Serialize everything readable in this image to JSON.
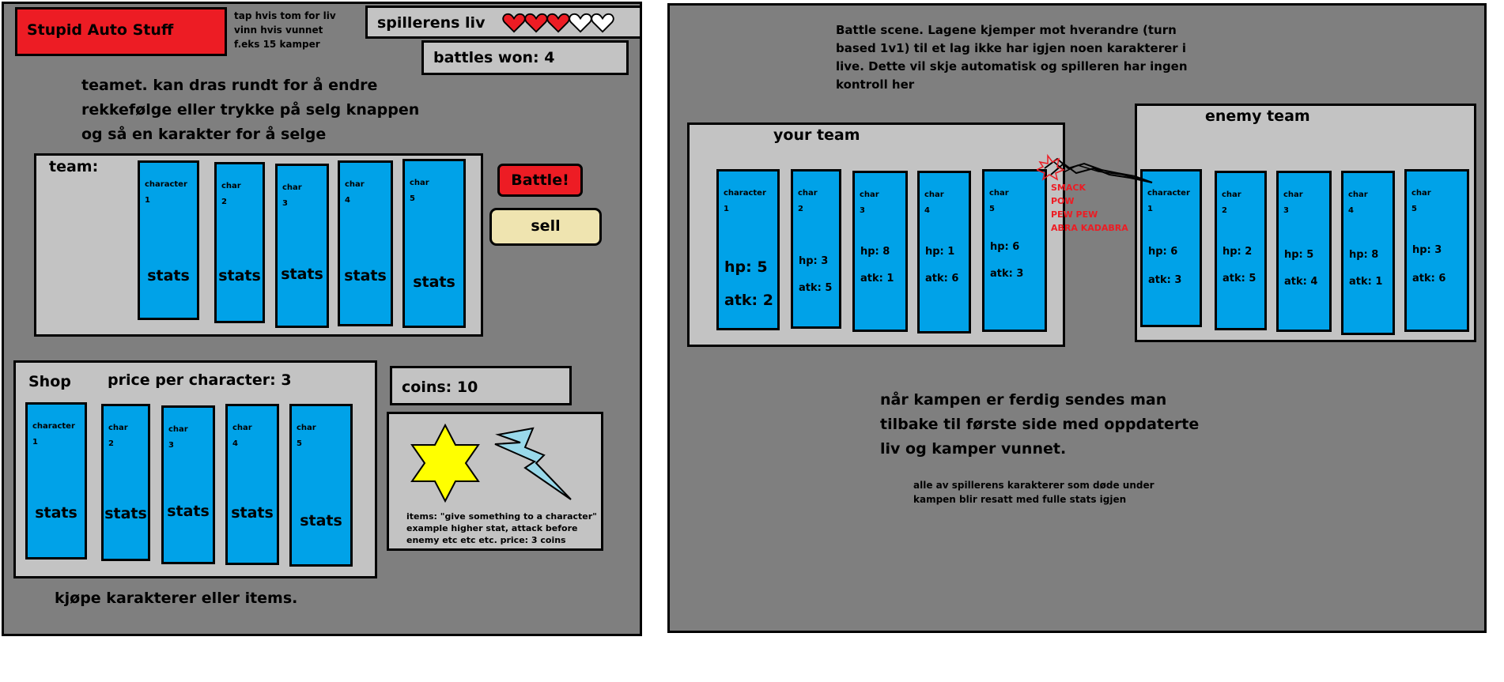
{
  "left": {
    "title": "Stupid Auto Stuff",
    "tap_note": "tap hvis tom for liv\nvinn hvis vunnet\nf.eks 15 kamper",
    "lives_label": "spillerens liv",
    "lives": {
      "filled": 3,
      "total": 5
    },
    "battles_won": "battles won: 4",
    "team_note": "teamet. kan dras rundt for å endre\nrekkefølge eller trykke på selg knappen\nog så en karakter for å selge",
    "team_label": "team:",
    "team": [
      {
        "name": "character\n1",
        "stats": "stats"
      },
      {
        "name": "char\n2",
        "stats": "stats"
      },
      {
        "name": "char\n3",
        "stats": "stats"
      },
      {
        "name": "char\n4",
        "stats": "stats"
      },
      {
        "name": "char\n5",
        "stats": "stats"
      }
    ],
    "battle_button": "Battle!",
    "sell_button": "sell",
    "shop_label": "Shop",
    "price_label": "price per character: 3",
    "shop": [
      {
        "name": "character\n1",
        "stats": "stats"
      },
      {
        "name": "char\n2",
        "stats": "stats"
      },
      {
        "name": "char\n3",
        "stats": "stats"
      },
      {
        "name": "char\n4",
        "stats": "stats"
      },
      {
        "name": "char\n5",
        "stats": "stats"
      }
    ],
    "coins": "coins: 10",
    "items_note": "items: \"give something to a character\"\nexample higher stat, attack before\nenemy etc etc etc. price: 3 coins",
    "shop_note": "kjøpe karakterer eller items."
  },
  "right": {
    "battle_note": "Battle scene. Lagene kjemper mot hverandre (turn\nbased 1v1) til et lag ikke har igjen noen karakterer i\nlive. Dette vil skje automatisk og spilleren har ingen\nkontroll her",
    "your_team_label": "your team",
    "enemy_team_label": "enemy team",
    "your_team": [
      {
        "name": "character\n1",
        "hp": "hp: 5",
        "atk": "atk: 2"
      },
      {
        "name": "char\n2",
        "hp": "hp: 3",
        "atk": "atk: 5"
      },
      {
        "name": "char\n3",
        "hp": "hp: 8",
        "atk": "atk: 1"
      },
      {
        "name": "char\n4",
        "hp": "hp: 1",
        "atk": "atk: 6"
      },
      {
        "name": "char\n5",
        "hp": "hp: 6",
        "atk": "atk: 3"
      }
    ],
    "enemy_team": [
      {
        "name": "character\n1",
        "hp": "hp: 6",
        "atk": "atk: 3"
      },
      {
        "name": "char\n2",
        "hp": "hp: 2",
        "atk": "atk: 5"
      },
      {
        "name": "char\n3",
        "hp": "hp: 5",
        "atk": "atk: 4"
      },
      {
        "name": "char\n4",
        "hp": "hp: 8",
        "atk": "atk: 1"
      },
      {
        "name": "char\n5",
        "hp": "hp: 3",
        "atk": "atk: 6"
      }
    ],
    "clash_text": "SMACK\nPOW\nPEW PEW\nABRA KADABRA",
    "end_note": "når kampen er ferdig sendes man\ntilbake til første side med oppdaterte\nliv og kamper vunnet.",
    "reset_note": "alle av spillerens karakterer som døde under\nkampen blir resatt med fulle stats igjen"
  },
  "colors": {
    "panel": "#7f7f7f",
    "box": "#c3c3c3",
    "card": "#00a2e8",
    "red": "#ed1c24",
    "sell": "#efe4b0",
    "star": "#ffff00",
    "lightning": "#99d9ea"
  }
}
